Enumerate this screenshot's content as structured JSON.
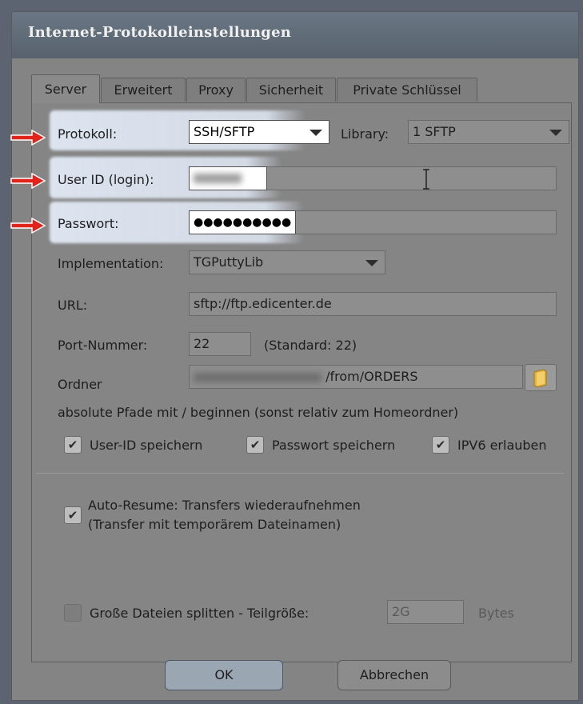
{
  "window": {
    "title": "Internet-Protokolleinstellungen"
  },
  "tabs": [
    {
      "label": "Server"
    },
    {
      "label": "Erweitert"
    },
    {
      "label": "Proxy"
    },
    {
      "label": "Sicherheit"
    },
    {
      "label": "Private Schlüssel"
    }
  ],
  "form": {
    "protocol_label": "Protokoll:",
    "protocol_value": "SSH/SFTP",
    "library_label": "Library:",
    "library_value": "1 SFTP",
    "userid_label": "User ID (login):",
    "userid_value": "",
    "password_label": "Passwort:",
    "password_value": "●●●●●●●●●●",
    "impl_label": "Implementation:",
    "impl_value": "TGPuttyLib",
    "url_label": "URL:",
    "url_value": "sftp://ftp.edicenter.de",
    "port_label": "Port-Nummer:",
    "port_value": "22",
    "port_default": "(Standard: 22)",
    "folder_label": "Ordner",
    "folder_value": "/from/ORDERS",
    "path_hint": "absolute Pfade mit / beginnen (sonst relativ zum Homeordner)"
  },
  "checkboxes": {
    "save_user": {
      "label": "User-ID speichern",
      "checked": true
    },
    "save_password": {
      "label": "Passwort speichern",
      "checked": true
    },
    "ipv6": {
      "label": "IPV6 erlauben",
      "checked": true
    },
    "auto_resume_line1": "Auto-Resume: Transfers wiederaufnehmen",
    "auto_resume_line2": "(Transfer mit temporärem Dateinamen)",
    "auto_resume_checked": true,
    "split_label": "Große Dateien splitten - Teilgröße:",
    "split_checked": false,
    "split_value": "2G",
    "split_unit": "Bytes"
  },
  "buttons": {
    "ok": "OK",
    "cancel": "Abbrechen"
  },
  "colors": {
    "highlight": "#e1e9f5",
    "arrow": "#e0231b"
  }
}
